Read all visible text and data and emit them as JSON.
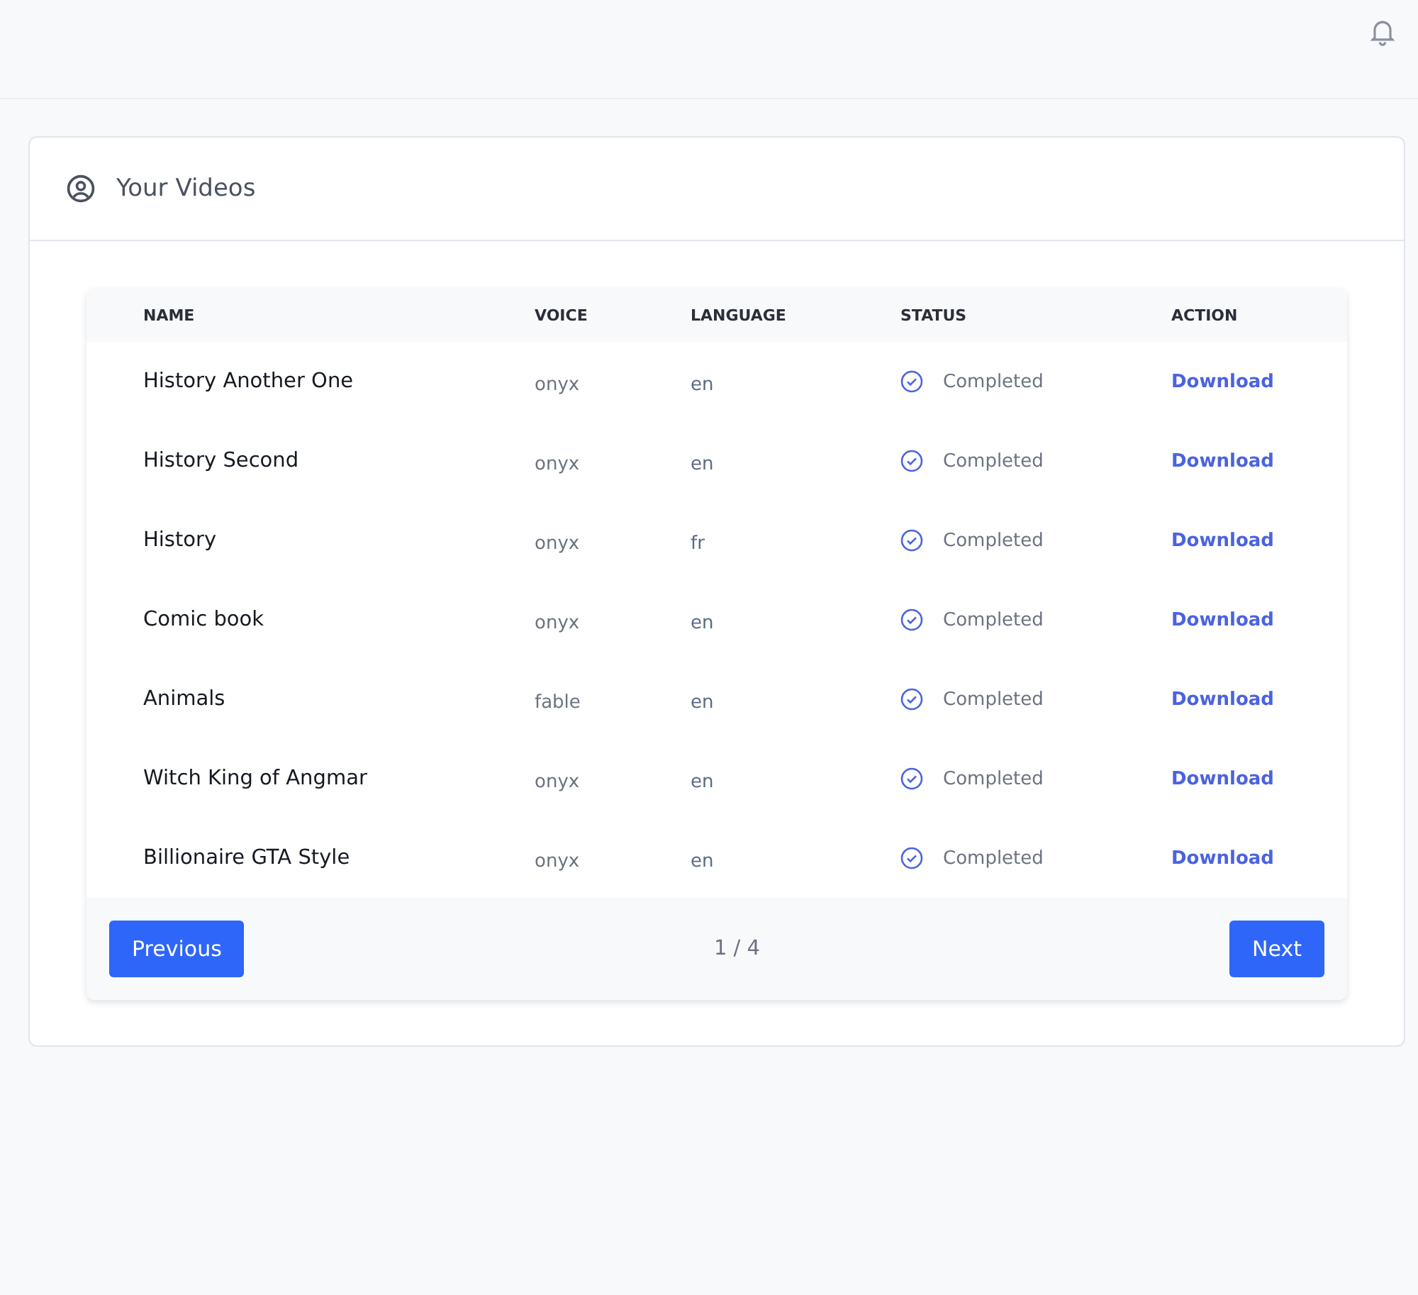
{
  "card": {
    "title": "Your Videos"
  },
  "table": {
    "columns": [
      "NAME",
      "VOICE",
      "LANGUAGE",
      "STATUS",
      "ACTION"
    ],
    "rows": [
      {
        "name": "History Another One",
        "voice": "onyx",
        "language": "en",
        "status": "Completed",
        "kind": "completed",
        "action": "Download"
      },
      {
        "name": "History Second",
        "voice": "onyx",
        "language": "en",
        "status": "Completed",
        "kind": "completed",
        "action": "Download"
      },
      {
        "name": "History",
        "voice": "onyx",
        "language": "fr",
        "status": "Completed",
        "kind": "completed",
        "action": "Download"
      },
      {
        "name": "Comic book",
        "voice": "onyx",
        "language": "en",
        "status": "Completed",
        "kind": "completed",
        "action": "Download"
      },
      {
        "name": "Animals",
        "voice": "fable",
        "language": "en",
        "status": "Completed",
        "kind": "completed",
        "action": "Download"
      },
      {
        "name": "Witch King of Angmar",
        "voice": "onyx",
        "language": "en",
        "status": "Completed",
        "kind": "completed",
        "action": "Download"
      },
      {
        "name": "Billionaire GTA Style",
        "voice": "onyx",
        "language": "en",
        "status": "Completed",
        "kind": "completed",
        "action": "Download"
      }
    ]
  },
  "pagination": {
    "previous": "Previous",
    "page": "1 / 4",
    "next": "Next"
  }
}
